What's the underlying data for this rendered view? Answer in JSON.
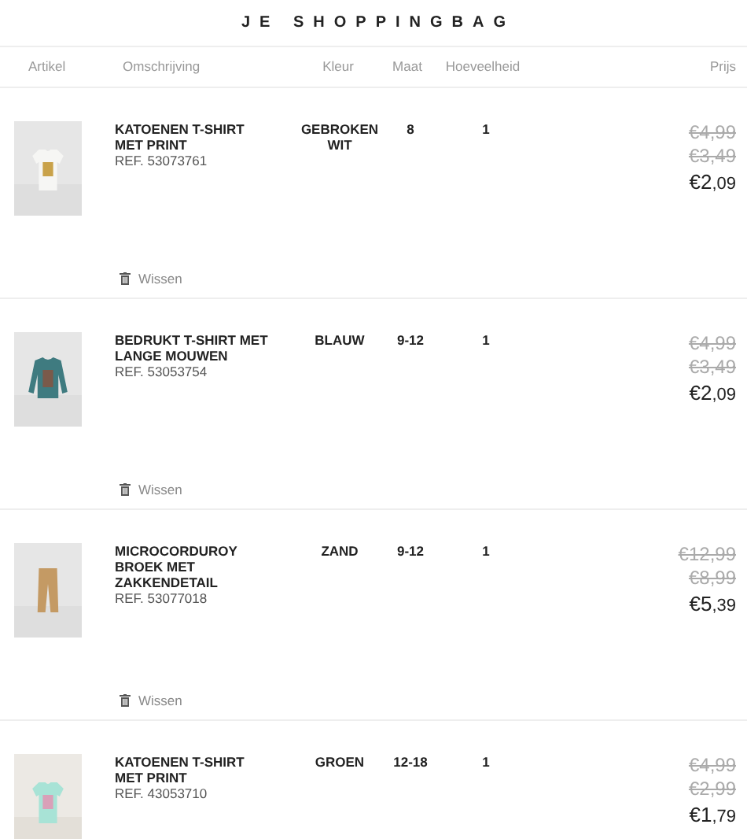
{
  "title": "JE SHOPPINGBAG",
  "columns": [
    "Artikel",
    "Omschrijving",
    "Kleur",
    "Maat",
    "Hoeveelheid",
    "Prijs"
  ],
  "items": [
    {
      "name": "KATOENEN T-SHIRT MET PRINT",
      "ref": "REF. 53073761",
      "kleur": "GEBROKEN WIT",
      "size": "8",
      "quantity": "1",
      "old_prices": [
        "€4,99",
        "€3,49"
      ],
      "price": {
        "euros": "€2",
        "cents": ",09"
      },
      "remove": "Wissen"
    },
    {
      "name": "BEDRUKT T-SHIRT MET LANGE MOUWEN",
      "ref": "REF. 53053754",
      "kleur": "BLAUW",
      "size": "9-12",
      "quantity": "1",
      "old_prices": [
        "€4,99",
        "€3,49"
      ],
      "price": {
        "euros": "€2",
        "cents": ",09"
      },
      "remove": "Wissen"
    },
    {
      "name": "MICROCORDUROY BROEK MET ZAKKENDETAIL",
      "ref": "REF. 53077018",
      "kleur": "ZAND",
      "size": "9-12",
      "quantity": "1",
      "old_prices": [
        "€12,99",
        "€8,99"
      ],
      "price": {
        "euros": "€5",
        "cents": ",39"
      },
      "remove": "Wissen"
    },
    {
      "name": "KATOENEN T-SHIRT MET PRINT",
      "ref": "REF. 43053710",
      "kleur": "GROEN",
      "size": "12-18",
      "quantity": "1",
      "old_prices": [
        "€4,99",
        "€2,99"
      ],
      "price": {
        "euros": "€1",
        "cents": ",79"
      }
    }
  ]
}
